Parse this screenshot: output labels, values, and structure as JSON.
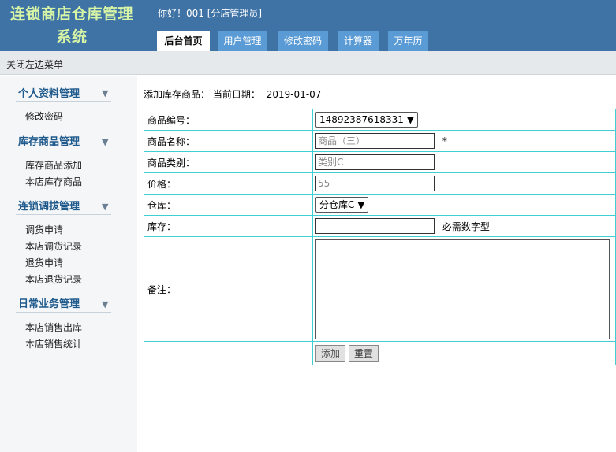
{
  "header": {
    "app_title_line1": "连锁商店仓库管理",
    "app_title_line2": "系统",
    "greeting": "你好！001 [分店管理员]",
    "tabs": [
      {
        "label": "后台首页",
        "active": true
      },
      {
        "label": "用户管理",
        "active": false
      },
      {
        "label": "修改密码",
        "active": false
      },
      {
        "label": "计算器",
        "active": false
      },
      {
        "label": "万年历",
        "active": false
      }
    ]
  },
  "toggle": {
    "label": "关闭左边菜单"
  },
  "sidebar": {
    "groups": [
      {
        "title": "个人资料管理",
        "items": [
          "修改密码"
        ]
      },
      {
        "title": "库存商品管理",
        "items": [
          "库存商品添加",
          "本店库存商品"
        ]
      },
      {
        "title": "连锁调拔管理",
        "items": [
          "调货申请",
          "本店调货记录",
          "退货申请",
          "本店退货记录"
        ]
      },
      {
        "title": "日常业务管理",
        "items": [
          "本店销售出库",
          "本店销售统计"
        ]
      }
    ]
  },
  "main": {
    "heading": "添加库存商品：",
    "date_label": "当前日期：",
    "date_value": "2019-01-07",
    "form": {
      "code_label": "商品编号：",
      "code_value": "14892387618331",
      "name_label": "商品名称：",
      "name_value": "商品（三）",
      "name_required": "*",
      "category_label": "商品类别：",
      "category_value": "类别C",
      "price_label": "价格：",
      "price_value": "55",
      "warehouse_label": "仓库：",
      "warehouse_value": "分仓库C",
      "stock_label": "库存：",
      "stock_value": "",
      "stock_hint": "必需数字型",
      "remark_label": "备注：",
      "add_button": "添加",
      "reset_button": "重置"
    }
  },
  "colors": {
    "header_bg": "#3f73a6",
    "title_color": "#d7f5a5",
    "tab_bg": "#5a9bd5",
    "table_border": "#3fcfd2",
    "sidebar_title": "#1f5a8c"
  }
}
